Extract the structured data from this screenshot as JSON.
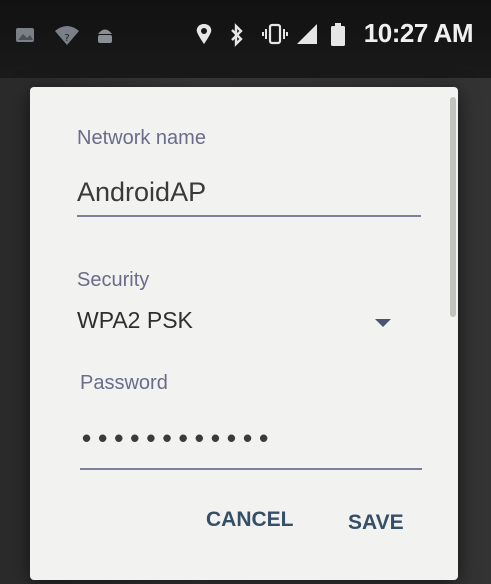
{
  "status_bar": {
    "time": "10:27 AM",
    "icons": [
      "gallery-icon",
      "wifi-question-icon",
      "android-icon",
      "location-icon",
      "bluetooth-icon",
      "vibrate-icon",
      "signal-icon",
      "battery-icon"
    ]
  },
  "dialog": {
    "network_name": {
      "label": "Network name",
      "value": "AndroidAP"
    },
    "security": {
      "label": "Security",
      "value": "WPA2 PSK"
    },
    "password": {
      "label": "Password",
      "value": "••••••••••••"
    },
    "buttons": {
      "cancel": "CANCEL",
      "save": "SAVE"
    }
  },
  "colors": {
    "dialog_bg": "#f2f2f0",
    "label": "#6a6c8a",
    "accent": "#364f68"
  }
}
